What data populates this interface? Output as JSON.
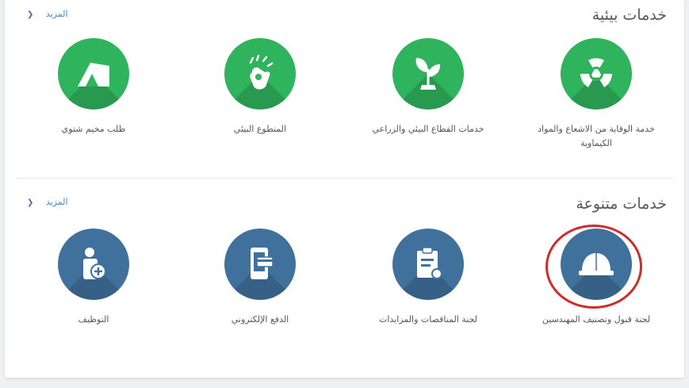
{
  "environmental": {
    "title": "خدمات بيئية",
    "more_label": "المزيد",
    "items": [
      {
        "label": "خدمة الوقاية من الاشعاع والمواد الكيماوية",
        "icon": "radiation-icon"
      },
      {
        "label": "خدمات القطاع البيئي والزراعي",
        "icon": "plant-sprout-icon"
      },
      {
        "label": "المتطوع البيئي",
        "icon": "volunteer-hand-icon"
      },
      {
        "label": "طلب مخيم شتوي",
        "icon": "tent-icon"
      }
    ]
  },
  "miscellaneous": {
    "title": "خدمات متنوعة",
    "more_label": "المزيد",
    "items": [
      {
        "label": "لجنة قبول وتصنيف المهندسين",
        "icon": "hard-hat-icon",
        "highlighted": true
      },
      {
        "label": "لجنة المناقصات والمزايدات",
        "icon": "clipboard-document-icon"
      },
      {
        "label": "الدفع الإلكتروني",
        "icon": "epayment-card-icon"
      },
      {
        "label": "التوظيف",
        "icon": "employment-add-user-icon"
      }
    ]
  },
  "colors": {
    "green": "#2fb35c",
    "blue": "#40709c",
    "highlight": "#d12b2b",
    "link": "#4a86c5"
  }
}
